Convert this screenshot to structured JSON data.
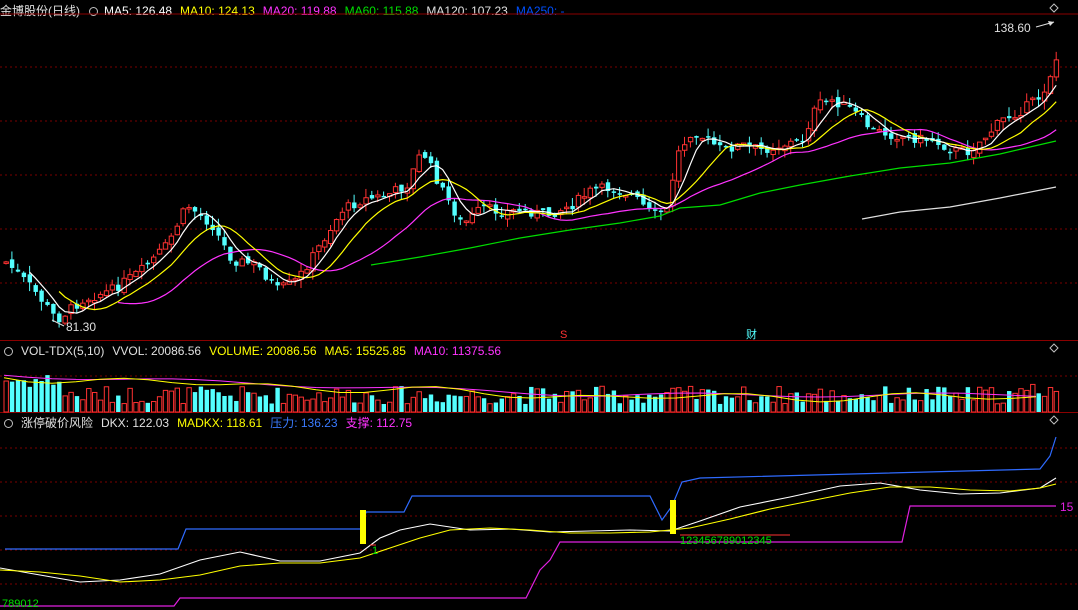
{
  "main": {
    "title": "金博股份(日线)",
    "ma5": "MA5: 126.48",
    "ma10": "MA10: 124.13",
    "ma20": "MA20: 119.88",
    "ma60": "MA60: 115.88",
    "ma120": "MA120: 107.23",
    "ma250": "MA250: -",
    "high_label": "138.60",
    "low_label": "81.30",
    "marker_s": "S",
    "marker_cai": "财",
    "colors": {
      "ma5": "#ffffff",
      "ma10": "#ffff00",
      "ma20": "#ff33ff",
      "ma60": "#00e000",
      "ma120": "#e0e0e0",
      "ma250": "#0050ff",
      "up": "#ff3232",
      "down": "#54ffff"
    }
  },
  "volume": {
    "title": "VOL-TDX(5,10)",
    "vvol": "VVOL: 20086.56",
    "volume": "VOLUME: 20086.56",
    "ma5": "MA5: 15525.85",
    "ma10": "MA10: 11375.56"
  },
  "indicator": {
    "title": "涨停破价风险",
    "dkx": "DKX: 122.03",
    "madkx": "MADKX: 118.61",
    "pressure": "压力: 136.23",
    "support": "支撑: 112.75",
    "right_value": "15",
    "count_left": "789012",
    "count_mid": "12345678901234 5",
    "count_mid_fix": "123456789012345"
  }
}
